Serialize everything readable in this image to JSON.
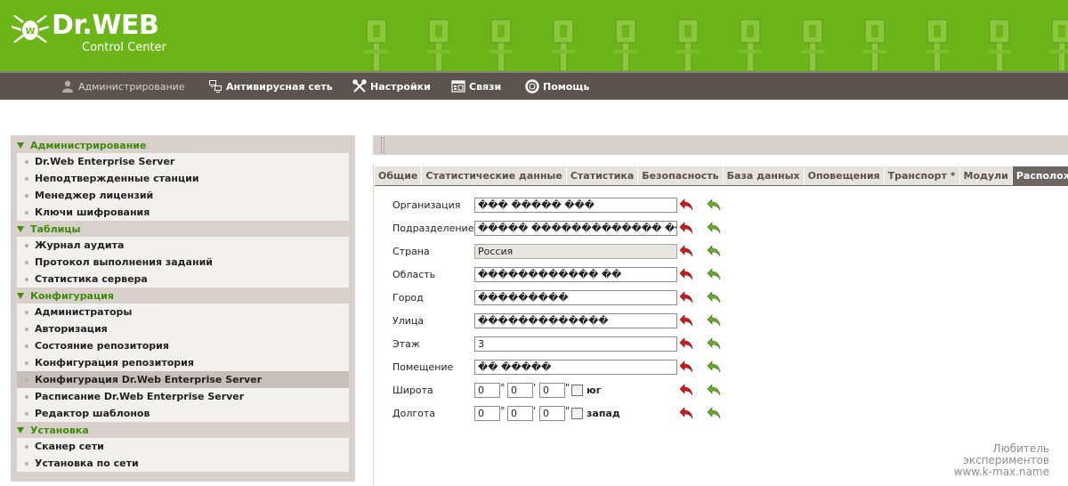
{
  "brand": {
    "name": "Dr.WEB",
    "subtitle": "Control Center"
  },
  "nav": [
    {
      "label": "Администрирование",
      "icon": "admin-user-icon"
    },
    {
      "label": "Антивирусная сеть",
      "icon": "network-computers-icon"
    },
    {
      "label": "Настройки",
      "icon": "settings-tools-icon"
    },
    {
      "label": "Связи",
      "icon": "connections-icon"
    },
    {
      "label": "Помощь",
      "icon": "help-lifebuoy-icon"
    }
  ],
  "sidebar": {
    "sections": [
      {
        "title": "Администрирование",
        "items": [
          "Dr.Web Enterprise Server",
          "Неподтвержденные станции",
          "Менеджер лицензий",
          "Ключи шифрования"
        ]
      },
      {
        "title": "Таблицы",
        "items": [
          "Журнал аудита",
          "Протокол выполнения заданий",
          "Статистика сервера"
        ]
      },
      {
        "title": "Конфигурация",
        "items": [
          "Администраторы",
          "Авторизация",
          "Состояние репозитория",
          "Конфигурация репозитория",
          "Конфигурация Dr.Web Enterprise Server",
          "Расписание Dr.Web Enterprise Server",
          "Редактор шаблонов"
        ]
      },
      {
        "title": "Установка",
        "items": [
          "Сканер сети",
          "Установка по сети"
        ]
      }
    ],
    "active_item": "Конфигурация Dr.Web Enterprise Server"
  },
  "tabs": [
    "Общие",
    "Статистические данные",
    "Статистика",
    "Безопасность",
    "База данных",
    "Оповещения",
    "Транспорт *",
    "Модули",
    "Расположение"
  ],
  "active_tab": "Расположение",
  "form": {
    "organization": {
      "label": "Организация",
      "value": "��� ����� ���"
    },
    "department": {
      "label": "Подразделение",
      "value": "����� ������������� ����������"
    },
    "country": {
      "label": "Страна",
      "value": "Россия"
    },
    "region": {
      "label": "Область",
      "value": "������������ ��"
    },
    "city": {
      "label": "Город",
      "value": "���������"
    },
    "street": {
      "label": "Улица",
      "value": "�������������"
    },
    "floor": {
      "label": "Этаж",
      "value": "3"
    },
    "room": {
      "label": "Помещение",
      "value": "�� �����"
    },
    "latitude": {
      "label": "Широта",
      "deg": "0",
      "min": "0",
      "sec": "0",
      "dir_label": "юг",
      "deg_sym": "°",
      "min_sym": "'",
      "sec_sym": "\""
    },
    "longitude": {
      "label": "Долгота",
      "deg": "0",
      "min": "0",
      "sec": "0",
      "dir_label": "запад",
      "deg_sym": "°",
      "min_sym": "'",
      "sec_sym": "\""
    }
  },
  "watermark": {
    "line1": "Любитель",
    "line2": "экспериментов",
    "line3": "www.k-max.name"
  },
  "colors": {
    "header_green": "#6cb519",
    "nav_brown": "#5b534d",
    "section_green": "#3f8a08",
    "undo_red": "#cc1b1b",
    "redo_green": "#6aa832"
  }
}
